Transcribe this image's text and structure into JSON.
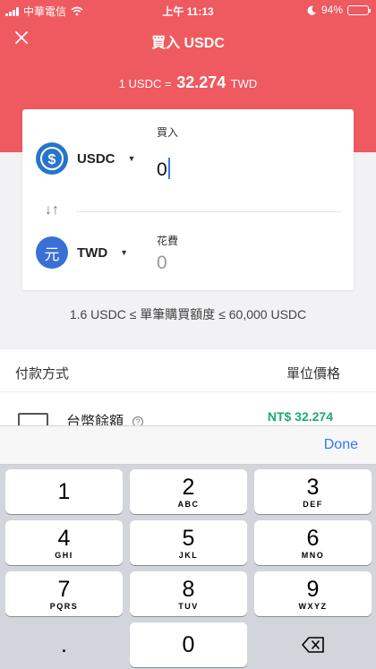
{
  "status": {
    "carrier": "中華電信",
    "time": "上午 11:13",
    "battery": "94%"
  },
  "nav": {
    "title": "買入 USDC"
  },
  "rate": {
    "prefix": "1 USDC =",
    "value": "32.274",
    "unit": "TWD"
  },
  "card": {
    "buy": {
      "coin": "USDC",
      "label": "買入",
      "value": "0"
    },
    "spend": {
      "coin": "TWD",
      "coin_glyph": "元",
      "label": "花費",
      "value": "0"
    }
  },
  "limits": "1.6 USDC ≤ 單筆購買額度 ≤ 60,000 USDC",
  "payment": {
    "method_header": "付款方式",
    "price_header": "單位價格",
    "option": {
      "name": "台幣餘額",
      "help": "?",
      "price": "NT$ 32.274"
    }
  },
  "keyboard": {
    "done": "Done",
    "keys": [
      {
        "num": "1",
        "letters": ""
      },
      {
        "num": "2",
        "letters": "ABC"
      },
      {
        "num": "3",
        "letters": "DEF"
      },
      {
        "num": "4",
        "letters": "GHI"
      },
      {
        "num": "5",
        "letters": "JKL"
      },
      {
        "num": "6",
        "letters": "MNO"
      },
      {
        "num": "7",
        "letters": "PQRS"
      },
      {
        "num": "8",
        "letters": "TUV"
      },
      {
        "num": "9",
        "letters": "WXYZ"
      },
      {
        "num": ".",
        "letters": ""
      },
      {
        "num": "0",
        "letters": ""
      }
    ]
  },
  "colors": {
    "header": "#ee5a5f",
    "accent": "#3477f6",
    "price": "#1eab6f",
    "usdc": "#2775ca",
    "twd": "#3a70d6"
  }
}
